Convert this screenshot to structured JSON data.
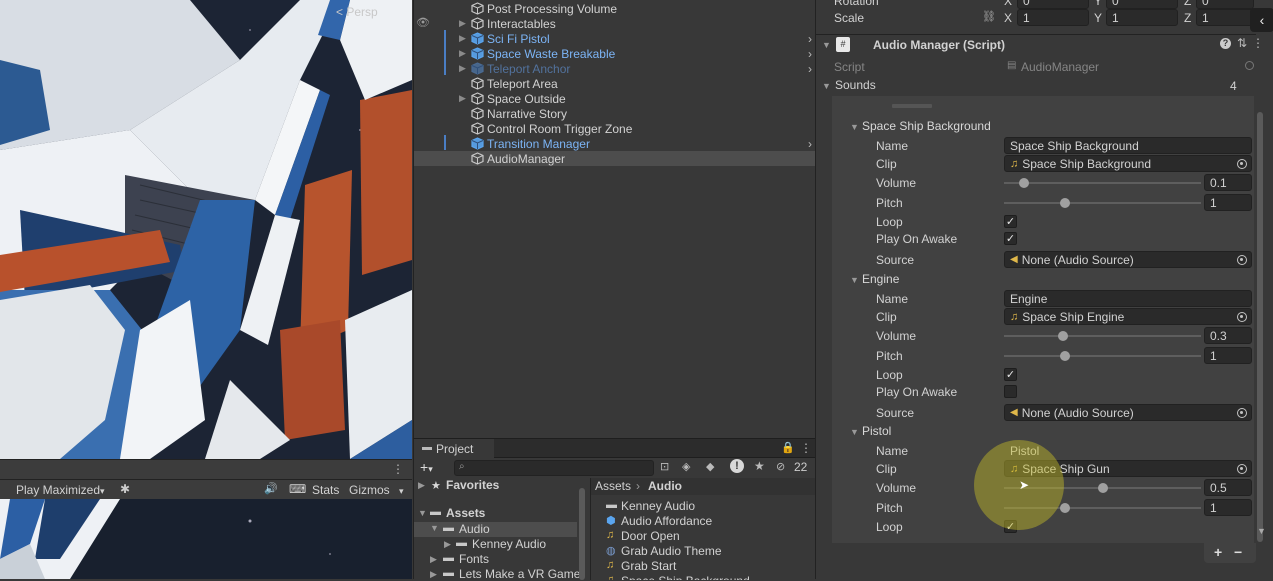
{
  "scene": {
    "label": "< Persp"
  },
  "game_toolbar": {
    "play_mode": "Play Maximized",
    "stats": "Stats",
    "gizmos": "Gizmos"
  },
  "hierarchy": {
    "items": [
      {
        "label": "Post Processing Volume",
        "style": "normal",
        "arrow": false,
        "chevron": false,
        "selected": false
      },
      {
        "label": "Interactables",
        "style": "normal",
        "arrow": true,
        "chevron": false,
        "selected": false
      },
      {
        "label": "Sci Fi Pistol",
        "style": "blue",
        "arrow": true,
        "chevron": true,
        "selected": false
      },
      {
        "label": "Space Waste Breakable",
        "style": "blue",
        "arrow": true,
        "chevron": true,
        "selected": false
      },
      {
        "label": "Teleport Anchor",
        "style": "dim-blue",
        "arrow": true,
        "chevron": true,
        "selected": false
      },
      {
        "label": "Teleport Area",
        "style": "normal",
        "arrow": false,
        "chevron": false,
        "selected": false
      },
      {
        "label": "Space Outside",
        "style": "normal",
        "arrow": true,
        "chevron": false,
        "selected": false
      },
      {
        "label": "Narrative Story",
        "style": "normal",
        "arrow": false,
        "chevron": false,
        "selected": false
      },
      {
        "label": "Control Room Trigger Zone",
        "style": "normal",
        "arrow": false,
        "chevron": false,
        "selected": false
      },
      {
        "label": "Transition Manager",
        "style": "blue",
        "arrow": false,
        "chevron": true,
        "selected": false
      },
      {
        "label": "AudioManager",
        "style": "normal",
        "arrow": false,
        "chevron": false,
        "selected": true
      }
    ]
  },
  "project": {
    "tab": "Project",
    "hidden_count": "22",
    "favorites": "Favorites",
    "assets": "Assets",
    "tree": [
      "Audio",
      "Kenney Audio",
      "Fonts",
      "Lets Make a VR Game"
    ],
    "breadcrumb": [
      "Assets",
      "Audio"
    ],
    "files": [
      {
        "label": "Kenney Audio",
        "type": "folder"
      },
      {
        "label": "Audio Affordance",
        "type": "prefab"
      },
      {
        "label": "Door Open",
        "type": "audio"
      },
      {
        "label": "Grab Audio Theme",
        "type": "audio-theme"
      },
      {
        "label": "Grab Start",
        "type": "audio"
      },
      {
        "label": "Space Ship Background",
        "type": "audio"
      }
    ]
  },
  "inspector": {
    "transform": {
      "rotation_label": "Rotation",
      "scale_label": "Scale",
      "x_label": "X",
      "y_label": "Y",
      "z_label": "Z",
      "rot_x": "0",
      "rot_y": "0",
      "rot_z": "0",
      "scale_x": "1",
      "scale_y": "1",
      "scale_z": "1"
    },
    "component": {
      "title": "Audio Manager (Script)",
      "script_label": "Script",
      "script_value": "AudioManager",
      "sounds_label": "Sounds",
      "sounds_count": "4"
    },
    "labels": {
      "name": "Name",
      "clip": "Clip",
      "volume": "Volume",
      "pitch": "Pitch",
      "loop": "Loop",
      "play_on_awake": "Play On Awake",
      "source": "Source"
    },
    "sounds": [
      {
        "header": "Space Ship Background",
        "name": "Space Ship Background",
        "clip": "Space Ship Background",
        "volume": 0.1,
        "volume_text": "0.1",
        "pitch": 1,
        "pitch_text": "1",
        "loop": true,
        "play_on_awake": true,
        "source": "None (Audio Source)"
      },
      {
        "header": "Engine",
        "name": "Engine",
        "clip": "Space Ship Engine",
        "volume": 0.3,
        "volume_text": "0.3",
        "pitch": 1,
        "pitch_text": "1",
        "loop": true,
        "play_on_awake": false,
        "source": "None (Audio Source)"
      },
      {
        "header": "Pistol",
        "name": "Pistol",
        "clip": "Space Ship Gun",
        "volume": 0.5,
        "volume_text": "0.5",
        "pitch": 1,
        "pitch_text": "1",
        "loop": true
      }
    ],
    "add_button": "+",
    "remove_button": "−"
  }
}
